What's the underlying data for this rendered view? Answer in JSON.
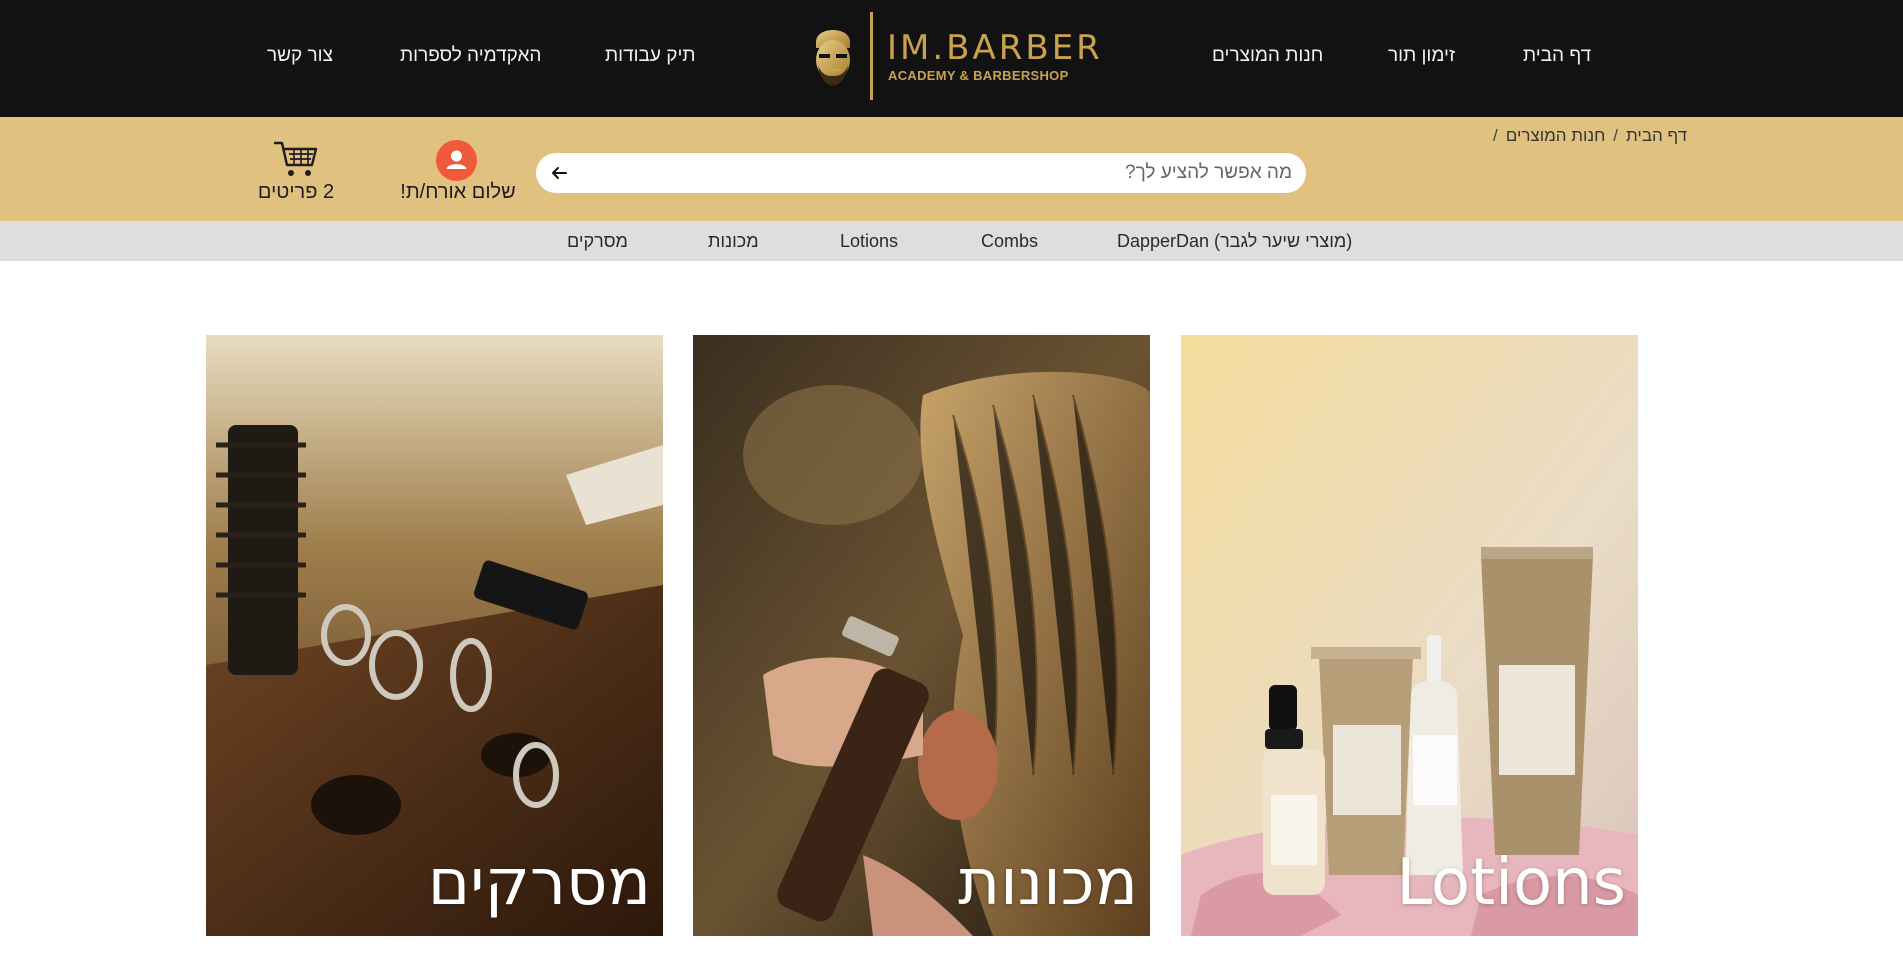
{
  "brand": {
    "name": "IM.BARBER",
    "tagline": "ACADEMY & BARBERSHOP",
    "gold": "#c9a24d"
  },
  "nav": {
    "home": "דף הבית",
    "booking": "זימון תור",
    "shop": "חנות המוצרים",
    "portfolio": "תיק עבודות",
    "academy": "האקדמיה לספרות",
    "contact": "צור קשר"
  },
  "breadcrumb": {
    "home": "דף הבית",
    "current": "חנות המוצרים",
    "separator": "/"
  },
  "search": {
    "placeholder": "מה אפשר להציע לך?",
    "submit_icon": "arrow-left-icon"
  },
  "user": {
    "greeting": "שלום אורח/ת!",
    "icon": "user-icon",
    "avatar_color": "#f05a3a"
  },
  "cart": {
    "count_label": "2 פריטים",
    "icon": "cart-icon"
  },
  "categories": {
    "dapperdan": "DapperDan (מוצרי שיער לגבר)",
    "combs": "Combs",
    "lotions": "Lotions",
    "clippers": "מכונות",
    "brushes": "מסרקים"
  },
  "tiles": {
    "lotions": "Lotions",
    "clippers": "מכונות",
    "brushes": "מסרקים"
  },
  "colors": {
    "header_bg": "#121212",
    "gold_bar": "#e1c17f",
    "category_bar": "#dedede"
  }
}
